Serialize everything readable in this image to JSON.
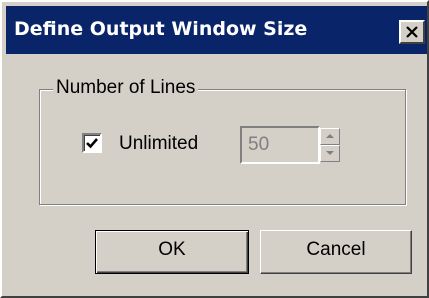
{
  "window": {
    "title": "Define Output Window Size",
    "close_icon": "close-icon"
  },
  "group": {
    "legend": "Number of Lines"
  },
  "unlimited": {
    "label": "Unlimited",
    "checked": true
  },
  "lines": {
    "value": "50",
    "disabled": true
  },
  "buttons": {
    "ok": "OK",
    "cancel": "Cancel"
  },
  "colors": {
    "titlebar": "#0a246a",
    "face": "#d4d0c8"
  }
}
